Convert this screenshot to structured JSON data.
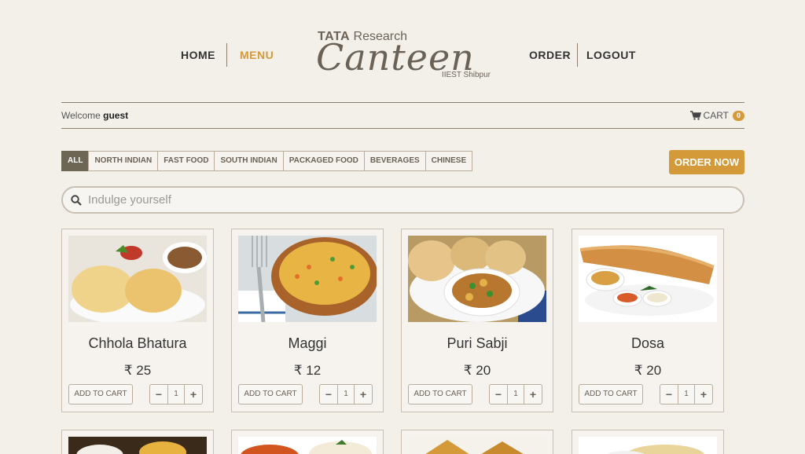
{
  "nav": {
    "home": "HOME",
    "menu": "MENU",
    "order": "ORDER",
    "logout": "LOGOUT"
  },
  "logo": {
    "brand_bold": "TATA",
    "brand_rest": " Research",
    "name": "Canteen",
    "subtitle": "IIEST Shibpur"
  },
  "welcome": {
    "prefix": "Welcome ",
    "user": "guest"
  },
  "cart": {
    "label": "CART",
    "count": "0",
    "icon": "shopping-cart-icon"
  },
  "categories": [
    "ALL",
    "NORTH INDIAN",
    "FAST FOOD",
    "SOUTH INDIAN",
    "PACKAGED FOOD",
    "BEVERAGES",
    "CHINESE"
  ],
  "active_category": "ALL",
  "order_now": "ORDER NOW",
  "search": {
    "placeholder": "Indulge yourself",
    "icon": "search-icon"
  },
  "items": [
    {
      "name": "Chhola Bhatura",
      "price": "₹ 25",
      "add_label": "ADD TO CART",
      "qty": "1",
      "minus": "−",
      "plus": "+"
    },
    {
      "name": "Maggi",
      "price": "₹ 12",
      "add_label": "ADD TO CART",
      "qty": "1",
      "minus": "−",
      "plus": "+"
    },
    {
      "name": "Puri Sabji",
      "price": "₹ 20",
      "add_label": "ADD TO CART",
      "qty": "1",
      "minus": "−",
      "plus": "+"
    },
    {
      "name": "Dosa",
      "price": "₹ 20",
      "add_label": "ADD TO CART",
      "qty": "1",
      "minus": "−",
      "plus": "+"
    }
  ],
  "colors": {
    "accent": "#d49a3a",
    "active_tab": "#6e6654",
    "background": "#f3f0ea"
  }
}
